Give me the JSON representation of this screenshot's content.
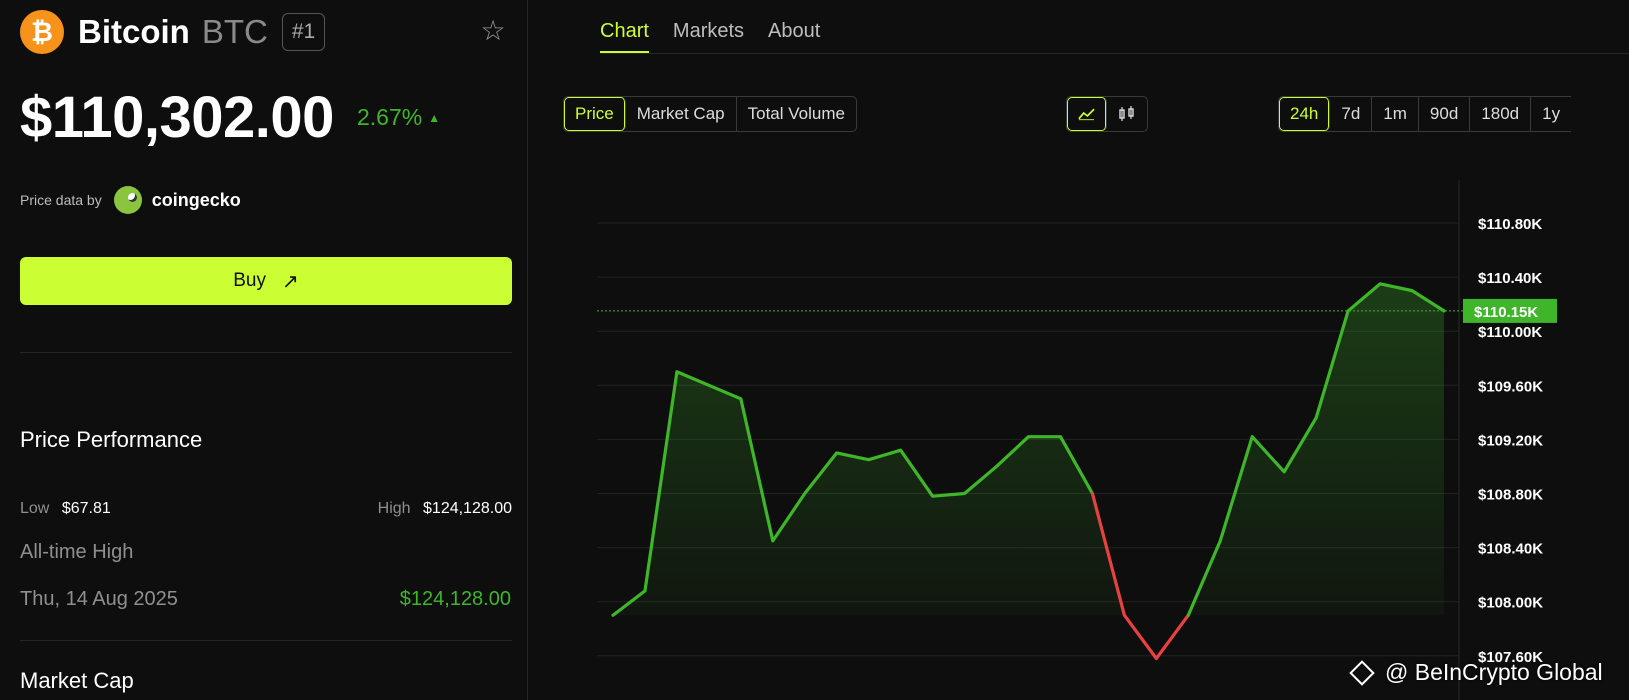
{
  "coin": {
    "logo_glyph": "₿",
    "name": "Bitcoin",
    "symbol": "BTC",
    "rank": "#1",
    "star_icon": "star-outline-icon"
  },
  "price": {
    "value": "$110,302.00",
    "change": "2.67%",
    "change_arrow": "▲"
  },
  "price_data": {
    "label": "Price data by",
    "provider": "coingecko"
  },
  "buy": {
    "label": "Buy",
    "arrow": "↗"
  },
  "performance": {
    "title": "Price Performance",
    "low_label": "Low",
    "low_value": "$67.81",
    "high_label": "High",
    "high_value": "$124,128.00",
    "ath_label": "All-time High",
    "ath_date": "Thu, 14 Aug 2025",
    "ath_value": "$124,128.00"
  },
  "market_cap": {
    "title": "Market Cap"
  },
  "tabs": [
    {
      "label": "Chart",
      "active": true
    },
    {
      "label": "Markets"
    },
    {
      "label": "About"
    }
  ],
  "metric_toggle": [
    {
      "label": "Price",
      "active": true
    },
    {
      "label": "Market Cap"
    },
    {
      "label": "Total Volume"
    }
  ],
  "chart_style": [
    {
      "icon": "line-chart-icon",
      "active": true
    },
    {
      "icon": "candlestick-icon"
    }
  ],
  "ranges": [
    {
      "label": "24h",
      "active": true
    },
    {
      "label": "7d"
    },
    {
      "label": "1m"
    },
    {
      "label": "90d"
    },
    {
      "label": "180d"
    },
    {
      "label": "1y"
    }
  ],
  "colors": {
    "accent": "#ccff33",
    "up": "#3fb52a",
    "down": "#e84142"
  },
  "watermark": "@ BeInCrypto Global",
  "chart_data": {
    "type": "area",
    "ylim": [
      107.8,
      110.9
    ],
    "yticks": [
      110.8,
      110.4,
      110.0,
      109.6,
      109.2,
      108.8,
      108.4,
      108.0,
      107.6
    ],
    "ytick_labels": [
      "$110.80K",
      "$110.40K",
      "$110.00K",
      "$109.60K",
      "$109.20K",
      "$108.80K",
      "$108.40K",
      "$108.00K",
      "$107.60K"
    ],
    "current": 110.15,
    "current_label": "$110.15K",
    "values": [
      107.9,
      108.08,
      109.7,
      109.6,
      109.5,
      108.45,
      108.8,
      109.1,
      109.05,
      109.12,
      108.78,
      108.8,
      109.0,
      109.22,
      109.22,
      108.8,
      107.9,
      107.58,
      107.9,
      108.45,
      109.22,
      108.96,
      109.36,
      110.15,
      110.35,
      110.3,
      110.15
    ],
    "down_segment": [
      15,
      18
    ]
  }
}
